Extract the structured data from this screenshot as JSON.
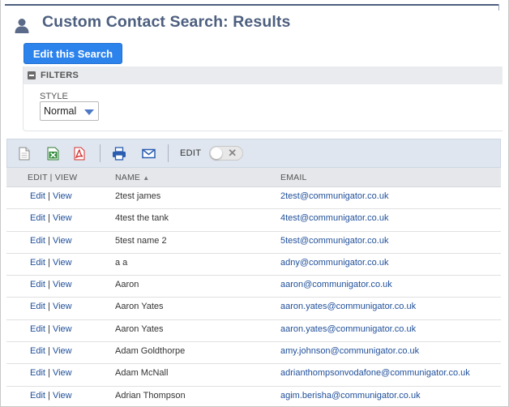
{
  "page": {
    "title": "Custom Contact Search: Results"
  },
  "actions": {
    "edit_search_label": "Edit this Search"
  },
  "filters": {
    "header_label": "FILTERS",
    "style_label": "STYLE",
    "style_value": "Normal"
  },
  "toolbar": {
    "icons": [
      "document-icon",
      "excel-icon",
      "pdf-icon",
      "print-icon",
      "email-icon"
    ],
    "edit_label": "EDIT",
    "edit_toggle": "off"
  },
  "table": {
    "columns": {
      "edit_view": "EDIT | VIEW",
      "name": "NAME",
      "email": "EMAIL"
    },
    "sort_indicator": "▲",
    "link_edit": "Edit",
    "link_sep": " | ",
    "link_view": "View",
    "rows": [
      {
        "name": "2test james",
        "email": "2test@communigator.co.uk"
      },
      {
        "name": "4test the tank",
        "email": "4test@communigator.co.uk"
      },
      {
        "name": "5test name 2",
        "email": "5test@communigator.co.uk"
      },
      {
        "name": "a a",
        "email": "adny@communigator.co.uk"
      },
      {
        "name": "Aaron",
        "email": "aaron@communigator.co.uk"
      },
      {
        "name": "Aaron Yates",
        "email": "aaron.yates@communigator.co.uk"
      },
      {
        "name": "Aaron Yates",
        "email": "aaron.yates@communigator.co.uk"
      },
      {
        "name": "Adam Goldthorpe",
        "email": "amy.johnson@communigator.co.uk"
      },
      {
        "name": "Adam McNall",
        "email": "adrianthompsonvodafone@communigator.co.uk"
      },
      {
        "name": "Adrian Thompson",
        "email": "agim.berisha@communigator.co.uk"
      }
    ]
  },
  "colors": {
    "title": "#4d5f7f",
    "button": "#2c83ec",
    "link": "#1f4f9a",
    "toolbar_bg": "#dfe6ef"
  }
}
